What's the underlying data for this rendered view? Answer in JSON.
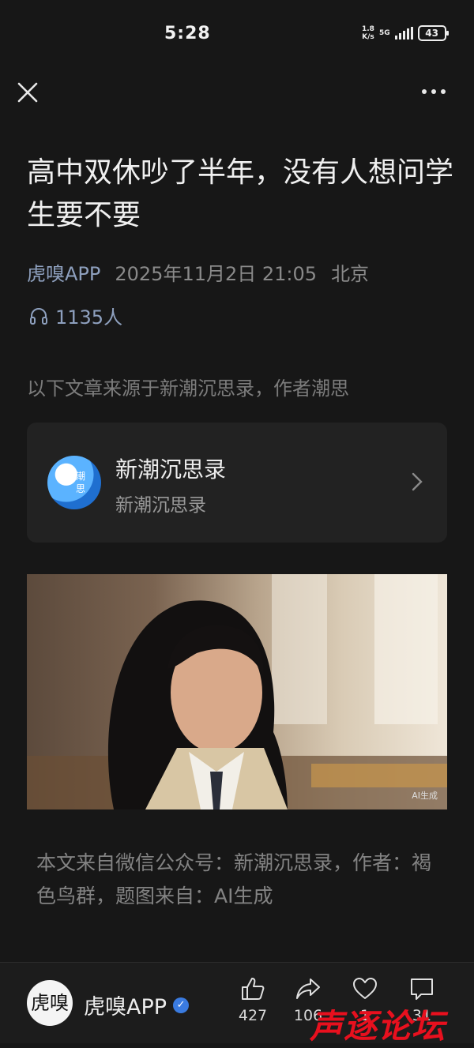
{
  "status_bar": {
    "time": "5:28",
    "net_speed_top": "1.8",
    "net_speed_bottom": "K/s",
    "network": "5G",
    "battery": "43"
  },
  "top_bar": {
    "close_icon": "close-icon",
    "more_icon": "more-dots-icon"
  },
  "article": {
    "title": "高中双休吵了半年，没有人想问学生要不要",
    "author": "虎嗅APP",
    "date": "2025年11月2日 21:05",
    "location": "北京",
    "listeners": "1135人",
    "source_line": "以下文章来源于新潮沉思录，作者潮思",
    "source_card": {
      "name": "新潮沉思录",
      "subtitle": "新潮沉思录",
      "logo_text": "潮思"
    },
    "image_tag": "AI生成",
    "credit": "本文来自微信公众号：新潮沉思录，作者：褐色鸟群，题图来自：AI生成"
  },
  "bottom_bar": {
    "avatar_text": "虎嗅",
    "name": "虎嗅APP",
    "verified_icon": "verified-badge-icon",
    "actions": [
      {
        "icon": "thumbs-up-icon",
        "count": "427"
      },
      {
        "icon": "share-icon",
        "count": "106"
      },
      {
        "icon": "heart-icon",
        "count": "1"
      },
      {
        "icon": "comment-icon",
        "count": "31"
      }
    ]
  },
  "watermark": "声逐论坛",
  "colors": {
    "background": "#171717",
    "author_accent": "#8ea0be",
    "watermark": "#e8101e"
  }
}
